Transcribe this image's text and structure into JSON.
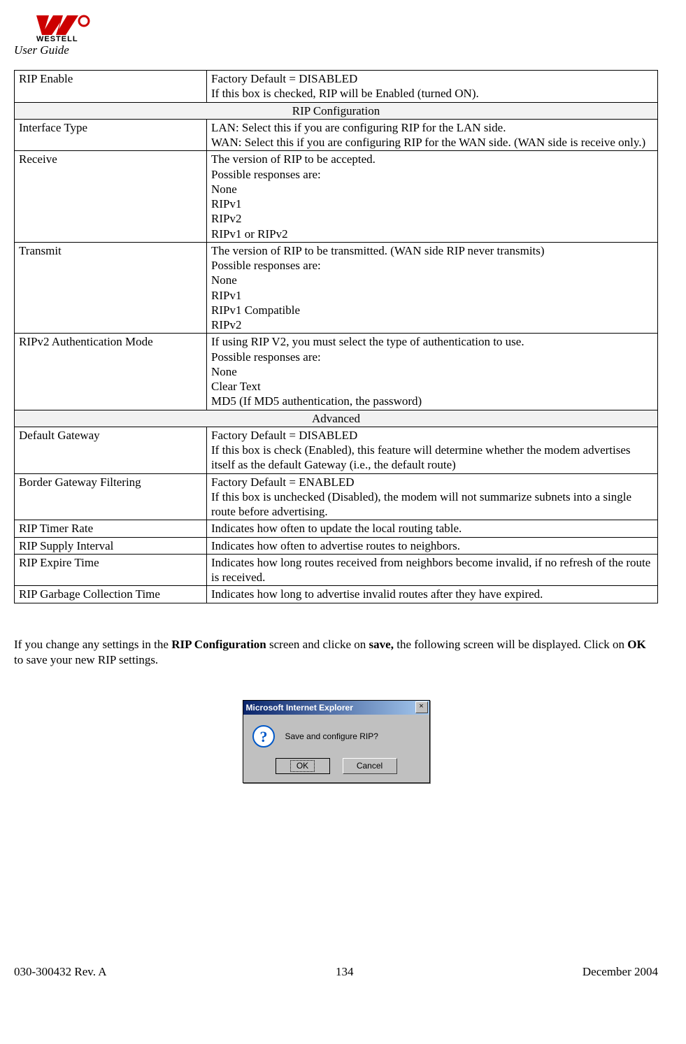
{
  "header": {
    "brand": "WESTELL",
    "subtitle": "User Guide"
  },
  "table": {
    "rows": [
      {
        "label": "RIP Enable",
        "desc": "Factory Default = DISABLED\nIf this box is checked, RIP will be Enabled (turned ON)."
      }
    ],
    "section1": "RIP Configuration",
    "rows2": [
      {
        "label": "Interface Type",
        "desc": "LAN: Select this if you are configuring RIP for the LAN side.\nWAN: Select this if you are configuring RIP for the WAN side. (WAN side is receive only.)"
      },
      {
        "label": "Receive",
        "desc": "The version of RIP to be accepted.\nPossible responses are:\nNone\nRIPv1\nRIPv2\nRIPv1 or RIPv2"
      },
      {
        "label": "Transmit",
        "desc": "The version of RIP to be transmitted. (WAN side RIP never transmits)\nPossible responses are:\nNone\nRIPv1\nRIPv1 Compatible\nRIPv2"
      },
      {
        "label": "RIPv2 Authentication Mode",
        "desc": "If using RIP V2, you must select the type of authentication to use.\nPossible responses are:\nNone\nClear Text\nMD5 (If MD5 authentication, the password)"
      }
    ],
    "section2": "Advanced",
    "rows3": [
      {
        "label": "Default Gateway",
        "desc": "Factory Default = DISABLED\nIf this box is check (Enabled), this feature will determine whether the modem advertises itself as the default Gateway (i.e., the default route)"
      },
      {
        "label": "Border Gateway Filtering",
        "desc": "Factory Default = ENABLED\nIf this box is unchecked (Disabled), the modem will not summarize subnets into a single route before advertising."
      },
      {
        "label": "RIP Timer Rate",
        "desc": "Indicates how often to update the local routing table."
      },
      {
        "label": "RIP Supply Interval",
        "desc": "Indicates how often to advertise routes to neighbors."
      },
      {
        "label": "RIP Expire Time",
        "desc": "Indicates how long routes received from neighbors become invalid, if no refresh of the route is received."
      },
      {
        "label": "RIP Garbage Collection Time",
        "desc": "Indicates how long to advertise invalid routes after they have expired."
      }
    ]
  },
  "body_para": {
    "t1": "If you change any settings in the ",
    "b1": "RIP Configuration",
    "t2": " screen and clicke on ",
    "b2": "save,",
    "t3": " the following screen will be displayed. Click on ",
    "b3": "OK",
    "t4": " to save your new RIP settings."
  },
  "dialog": {
    "title": "Microsoft Internet Explorer",
    "message": "Save and configure RIP?",
    "ok": "OK",
    "cancel": "Cancel",
    "close": "×"
  },
  "footer": {
    "left": "030-300432 Rev. A",
    "center": "134",
    "right": "December 2004"
  }
}
